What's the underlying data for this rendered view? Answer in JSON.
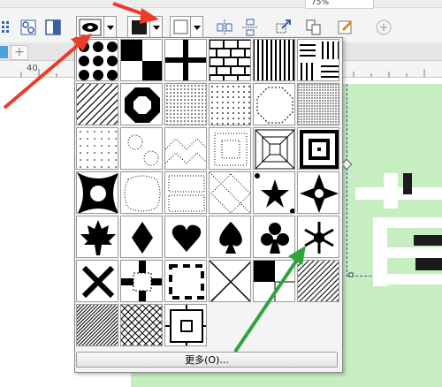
{
  "toolbar": {
    "zoom_value": "75%",
    "pattern_picker_icon": "pattern-swatch-icon",
    "color_picker_icon": "fill-color-swatch-icon",
    "outline_picker_icon": "outline-swatch-icon"
  },
  "tabs": {
    "add_tab_label": "+"
  },
  "ruler": {
    "label": "40"
  },
  "canvas": {
    "glyph": "黄"
  },
  "popup": {
    "more_button_label": "更多(O)...",
    "patterns": [
      "black-dots",
      "large-checkerboard",
      "cross-grid",
      "brick",
      "vertical-lines",
      "stripe-blocks",
      "diagonal-dots",
      "octagon-ring",
      "diagonal-speckle",
      "scattered-dots",
      "octagon-outline",
      "fine-dots",
      "sparse-dots",
      "dotted-rings",
      "dotted-chevron",
      "dotted-squares",
      "pyramid-lines",
      "concentric-squares",
      "black-quatrefoil",
      "dotted-quatrefoil",
      "dotted-grid",
      "dotted-diamonds",
      "star",
      "compass-star",
      "maple-leaf",
      "diamond-suit",
      "heart-suit",
      "spade-suit",
      "club-suit",
      "snowflake",
      "x-cross",
      "dashed-frame",
      "bracket-frame",
      "diagonal-cross",
      "half-black-squares",
      "diagonal-lines",
      "fine-diagonal",
      "lattice",
      "nested-frame"
    ]
  },
  "colors": {
    "canvas_green": "#c6eec0",
    "arrow_red": "#ee3a2a",
    "arrow_green": "#2fa33c"
  }
}
